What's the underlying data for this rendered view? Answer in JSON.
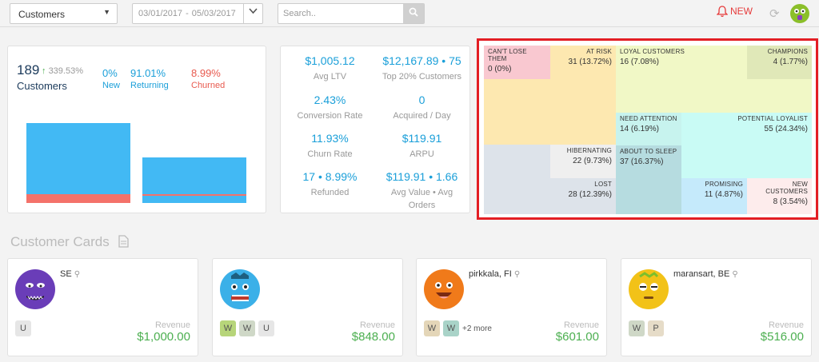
{
  "topbar": {
    "segment_select": "Customers",
    "date_range_start": "03/01/2017",
    "date_range_end": "05/03/2017",
    "date_separator": "-",
    "search_placeholder": "Search..",
    "new_label": "NEW"
  },
  "summary": {
    "customers_count": "189",
    "customers_change": "339.53%",
    "customers_label": "Customers",
    "new_value": "0%",
    "new_label": "New",
    "returning_value": "91.01%",
    "returning_label": "Returning",
    "churned_value": "8.99%",
    "churned_label": "Churned",
    "bars": [
      {
        "name": "Returning",
        "value": 91.01
      },
      {
        "name": "Churned",
        "value": 8.99
      }
    ]
  },
  "metrics": [
    {
      "value": "$1,005.12",
      "label": "Avg LTV"
    },
    {
      "value": "$12,167.89 • 75",
      "label": "Top 20% Customers"
    },
    {
      "value": "2.43%",
      "label": "Conversion Rate"
    },
    {
      "value": "0",
      "label": "Acquired / Day"
    },
    {
      "value": "11.93%",
      "label": "Churn Rate"
    },
    {
      "value": "$119.91",
      "label": "ARPU"
    },
    {
      "value": "17 • 8.99%",
      "label": "Refunded"
    },
    {
      "value": "$119.91 • 1.66",
      "label": "Avg Value • Avg Orders"
    }
  ],
  "segments": [
    {
      "name": "CAN'T LOSE THEM",
      "count": "0 (0%)",
      "color": "#f9c8d0"
    },
    {
      "name": "AT RISK",
      "count": "31 (13.72%)",
      "color": "#fde8b0"
    },
    {
      "name": "LOYAL CUSTOMERS",
      "count": "16 (7.08%)",
      "color": "#f1f8c6"
    },
    {
      "name": "CHAMPIONS",
      "count": "4 (1.77%)",
      "color": "#e0e8b8"
    },
    {
      "name": "NEED ATTENTION",
      "count": "14 (6.19%)",
      "color": "#c7f3ee"
    },
    {
      "name": "POTENTIAL LOYALIST",
      "count": "55 (24.34%)",
      "color": "#c9fbf5"
    },
    {
      "name": "HIBERNATING",
      "count": "22 (9.73%)",
      "color": "#efefef"
    },
    {
      "name": "ABOUT TO SLEEP",
      "count": "37 (16.37%)",
      "color": "#b6dce0"
    },
    {
      "name": "LOST",
      "count": "28 (12.39%)",
      "color": "#dde3ea"
    },
    {
      "name": "PROMISING",
      "count": "11 (4.87%)",
      "color": "#c5eafb"
    },
    {
      "name": "NEW CUSTOMERS",
      "count": "8 (3.54%)",
      "color": "#fdecec"
    }
  ],
  "cards_section": {
    "title": "Customer Cards"
  },
  "customer_cards": [
    {
      "location": "SE",
      "revenue_label": "Revenue",
      "revenue": "$1,000.00",
      "avatar_color": "#6a3db8",
      "badges": [
        "U"
      ],
      "more": ""
    },
    {
      "location": "",
      "revenue_label": "Revenue",
      "revenue": "$848.00",
      "avatar_color": "#3bb0e8",
      "badges": [
        "W",
        "W",
        "U"
      ],
      "more": ""
    },
    {
      "location": "pirkkala, FI",
      "revenue_label": "Revenue",
      "revenue": "$601.00",
      "avatar_color": "#f07a1a",
      "badges": [
        "W",
        "W"
      ],
      "more": "+2 more"
    },
    {
      "location": "maransart, BE",
      "revenue_label": "Revenue",
      "revenue": "$516.00",
      "avatar_color": "#f2c218",
      "badges": [
        "W",
        "P"
      ],
      "more": ""
    }
  ]
}
